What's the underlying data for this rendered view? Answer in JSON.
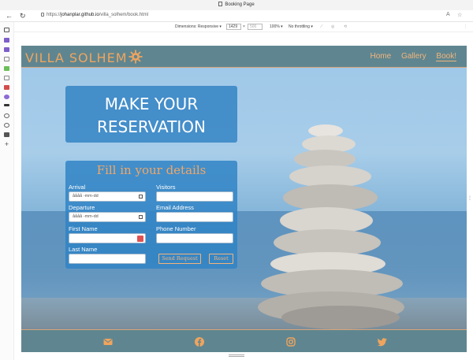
{
  "browser": {
    "tab_title": "Booking Page",
    "url_scheme": "https://",
    "url_host": "johanplar.github.io",
    "url_path": "/villa_solhem/book.html"
  },
  "devtools": {
    "dimensions_label": "Dimensions: Responsive ▾",
    "width_value": "1429",
    "times": "×",
    "height_value": "500",
    "zoom": "100% ▾",
    "throttling": "No throttling ▾"
  },
  "site": {
    "logo": "VILLA SOLHEM",
    "nav": [
      {
        "label": "Home"
      },
      {
        "label": "Gallery"
      },
      {
        "label": "Book!"
      }
    ],
    "hero_line1": "MAKE YOUR",
    "hero_line2": "RESERVATION",
    "form_title": "Fill in your details",
    "fields": {
      "arrival_label": "Arrival",
      "arrival_value": "åååå -mm-dd",
      "departure_label": "Departure",
      "departure_value": "åååå -mm-dd",
      "first_name_label": "First Name",
      "last_name_label": "Last Name",
      "visitors_label": "Visitors",
      "email_label": "Email Address",
      "phone_label": "Phone Number"
    },
    "buttons": {
      "send": "Send Request",
      "reset": "Reset"
    },
    "footer_icons": [
      "envelope-icon",
      "facebook-icon",
      "instagram-icon",
      "twitter-icon"
    ],
    "colors": {
      "header": "#5f8690",
      "accent": "#f0a45e",
      "panel": "#3084c6"
    }
  }
}
